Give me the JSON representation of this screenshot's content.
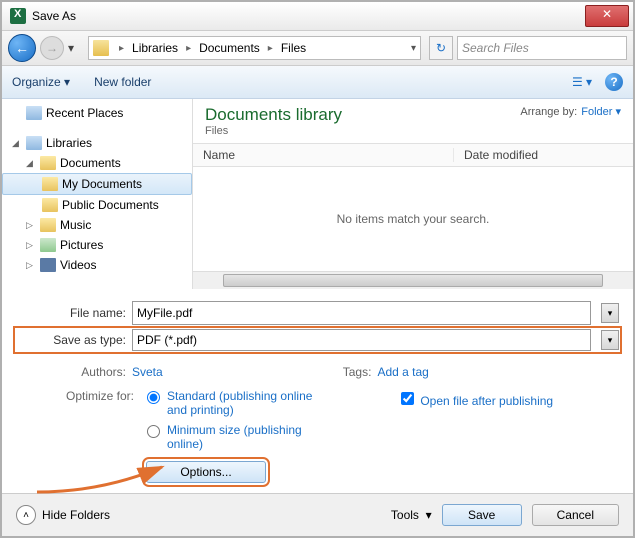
{
  "window": {
    "title": "Save As"
  },
  "nav": {
    "breadcrumb": [
      "Libraries",
      "Documents",
      "Files"
    ],
    "search_placeholder": "Search Files"
  },
  "toolbar": {
    "organize": "Organize",
    "new_folder": "New folder"
  },
  "sidebar": {
    "recent_places": "Recent Places",
    "libraries": "Libraries",
    "documents": "Documents",
    "my_documents": "My Documents",
    "public_documents": "Public Documents",
    "music": "Music",
    "pictures": "Pictures",
    "videos": "Videos"
  },
  "main": {
    "lib_title": "Documents library",
    "lib_sub": "Files",
    "arrange_label": "Arrange by:",
    "arrange_value": "Folder",
    "col_name": "Name",
    "col_date": "Date modified",
    "empty": "No items match your search."
  },
  "form": {
    "filename_label": "File name:",
    "filename_value": "MyFile.pdf",
    "savetype_label": "Save as type:",
    "savetype_value": "PDF (*.pdf)",
    "authors_label": "Authors:",
    "authors_value": "Sveta",
    "tags_label": "Tags:",
    "tags_value": "Add a tag",
    "optimize_label": "Optimize for:",
    "opt_standard": "Standard (publishing online and printing)",
    "opt_minimum": "Minimum size (publishing online)",
    "open_after": "Open file after publishing",
    "options_btn": "Options..."
  },
  "footer": {
    "hide_folders": "Hide Folders",
    "tools": "Tools",
    "save": "Save",
    "cancel": "Cancel"
  }
}
